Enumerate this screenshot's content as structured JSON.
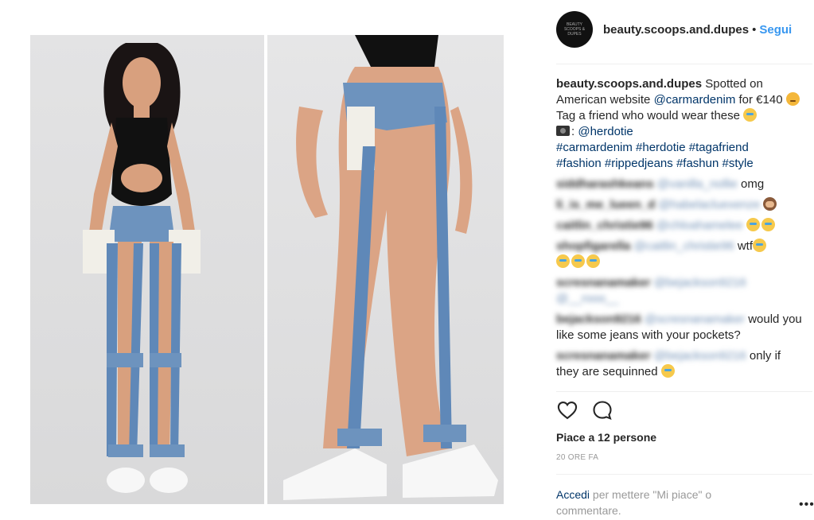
{
  "post": {
    "username": "beauty.scoops.and.dupes",
    "separator": "•",
    "follow_label": "Segui",
    "avatar_text": "BEAUTY SCOOPS & DUPES"
  },
  "caption": {
    "username": "beauty.scoops.and.dupes",
    "text1": "Spotted on American website",
    "mention1": "@carmardenim",
    "text2": "for €140",
    "text3": "Tag a friend who would wear these",
    "mention2": "@herdotie",
    "hashtags1": "#carmardenim #herdotie #tagafriend",
    "hashtags2": "#fashion #rippedjeans #fashun #style"
  },
  "comments": [
    {
      "user": "siddharashkeans",
      "mention": "@vanilla_nollie",
      "text": "omg"
    },
    {
      "user": "li_is_me_lueen_d",
      "mention": "@habelacluexenze",
      "text": ""
    },
    {
      "user": "caitlin_christie96",
      "mention": "@chloahamelee",
      "text": ""
    },
    {
      "user": "shopfigarella",
      "mention": "@caitlin_christie96",
      "text": "wtf"
    },
    {
      "user": "scresnanamaker",
      "mention": "@bejackson9216 @__rooo__",
      "text": ""
    },
    {
      "user": "bejackson9216",
      "mention": "@scresnanamaker",
      "text": "would you like some jeans with your pockets?"
    },
    {
      "user": "scresnanamaker",
      "mention": "@bejackson9216",
      "text": "only if they are sequinned"
    }
  ],
  "likes_text": "Piace a 12 persone",
  "time_text": "20 ORE FA",
  "login": {
    "link": "Accedi",
    "text": "per mettere \"Mi piace\" o commentare."
  },
  "more_label": "•••",
  "icons": {
    "like": "heart-icon",
    "comment": "comment-bubble-icon"
  },
  "colors": {
    "link": "#003569",
    "follow": "#3897f0",
    "muted": "#999999"
  }
}
